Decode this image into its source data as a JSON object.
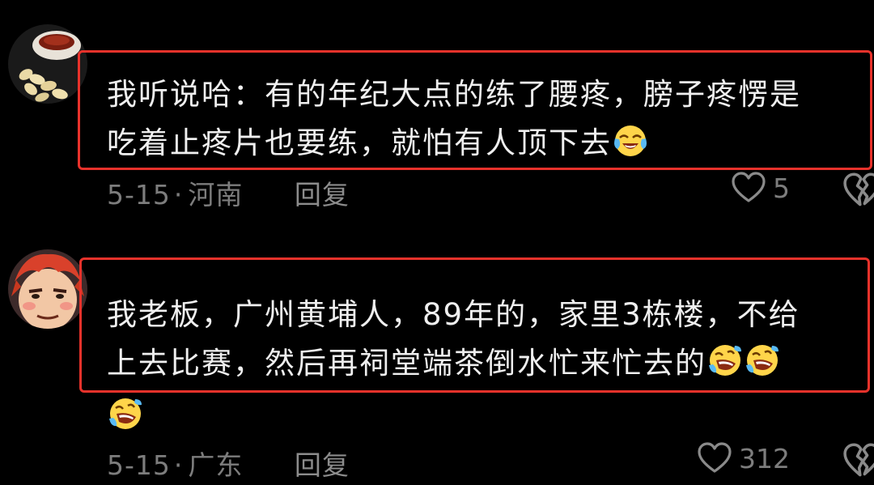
{
  "comments": [
    {
      "lines": [
        "我听说哈：有的年纪大点的练了腰疼，膀子疼愣是",
        "吃着止疼片也要练，就怕有人顶下去"
      ],
      "date": "5-15",
      "separator": "·",
      "region": "河南",
      "reply_label": "回复",
      "like_count": "5",
      "avatar_icon": "tea-and-peanuts-avatar",
      "emoji_icon": "crying-laughing-face-icon"
    },
    {
      "lines": [
        "我老板，广州黄埔人，89年的，家里3栋楼，不给",
        "上去比赛，然后再祠堂端茶倒水忙来忙去的",
        ""
      ],
      "date": "5-15",
      "separator": "·",
      "region": "广东",
      "reply_label": "回复",
      "like_count": "312",
      "avatar_icon": "anime-character-avatar",
      "emoji_icon": "rolling-laughing-face-icon"
    }
  ],
  "colors": {
    "background": "#000000",
    "text": "#efefef",
    "meta": "#7d7d7d",
    "highlight": "#e8322b"
  }
}
